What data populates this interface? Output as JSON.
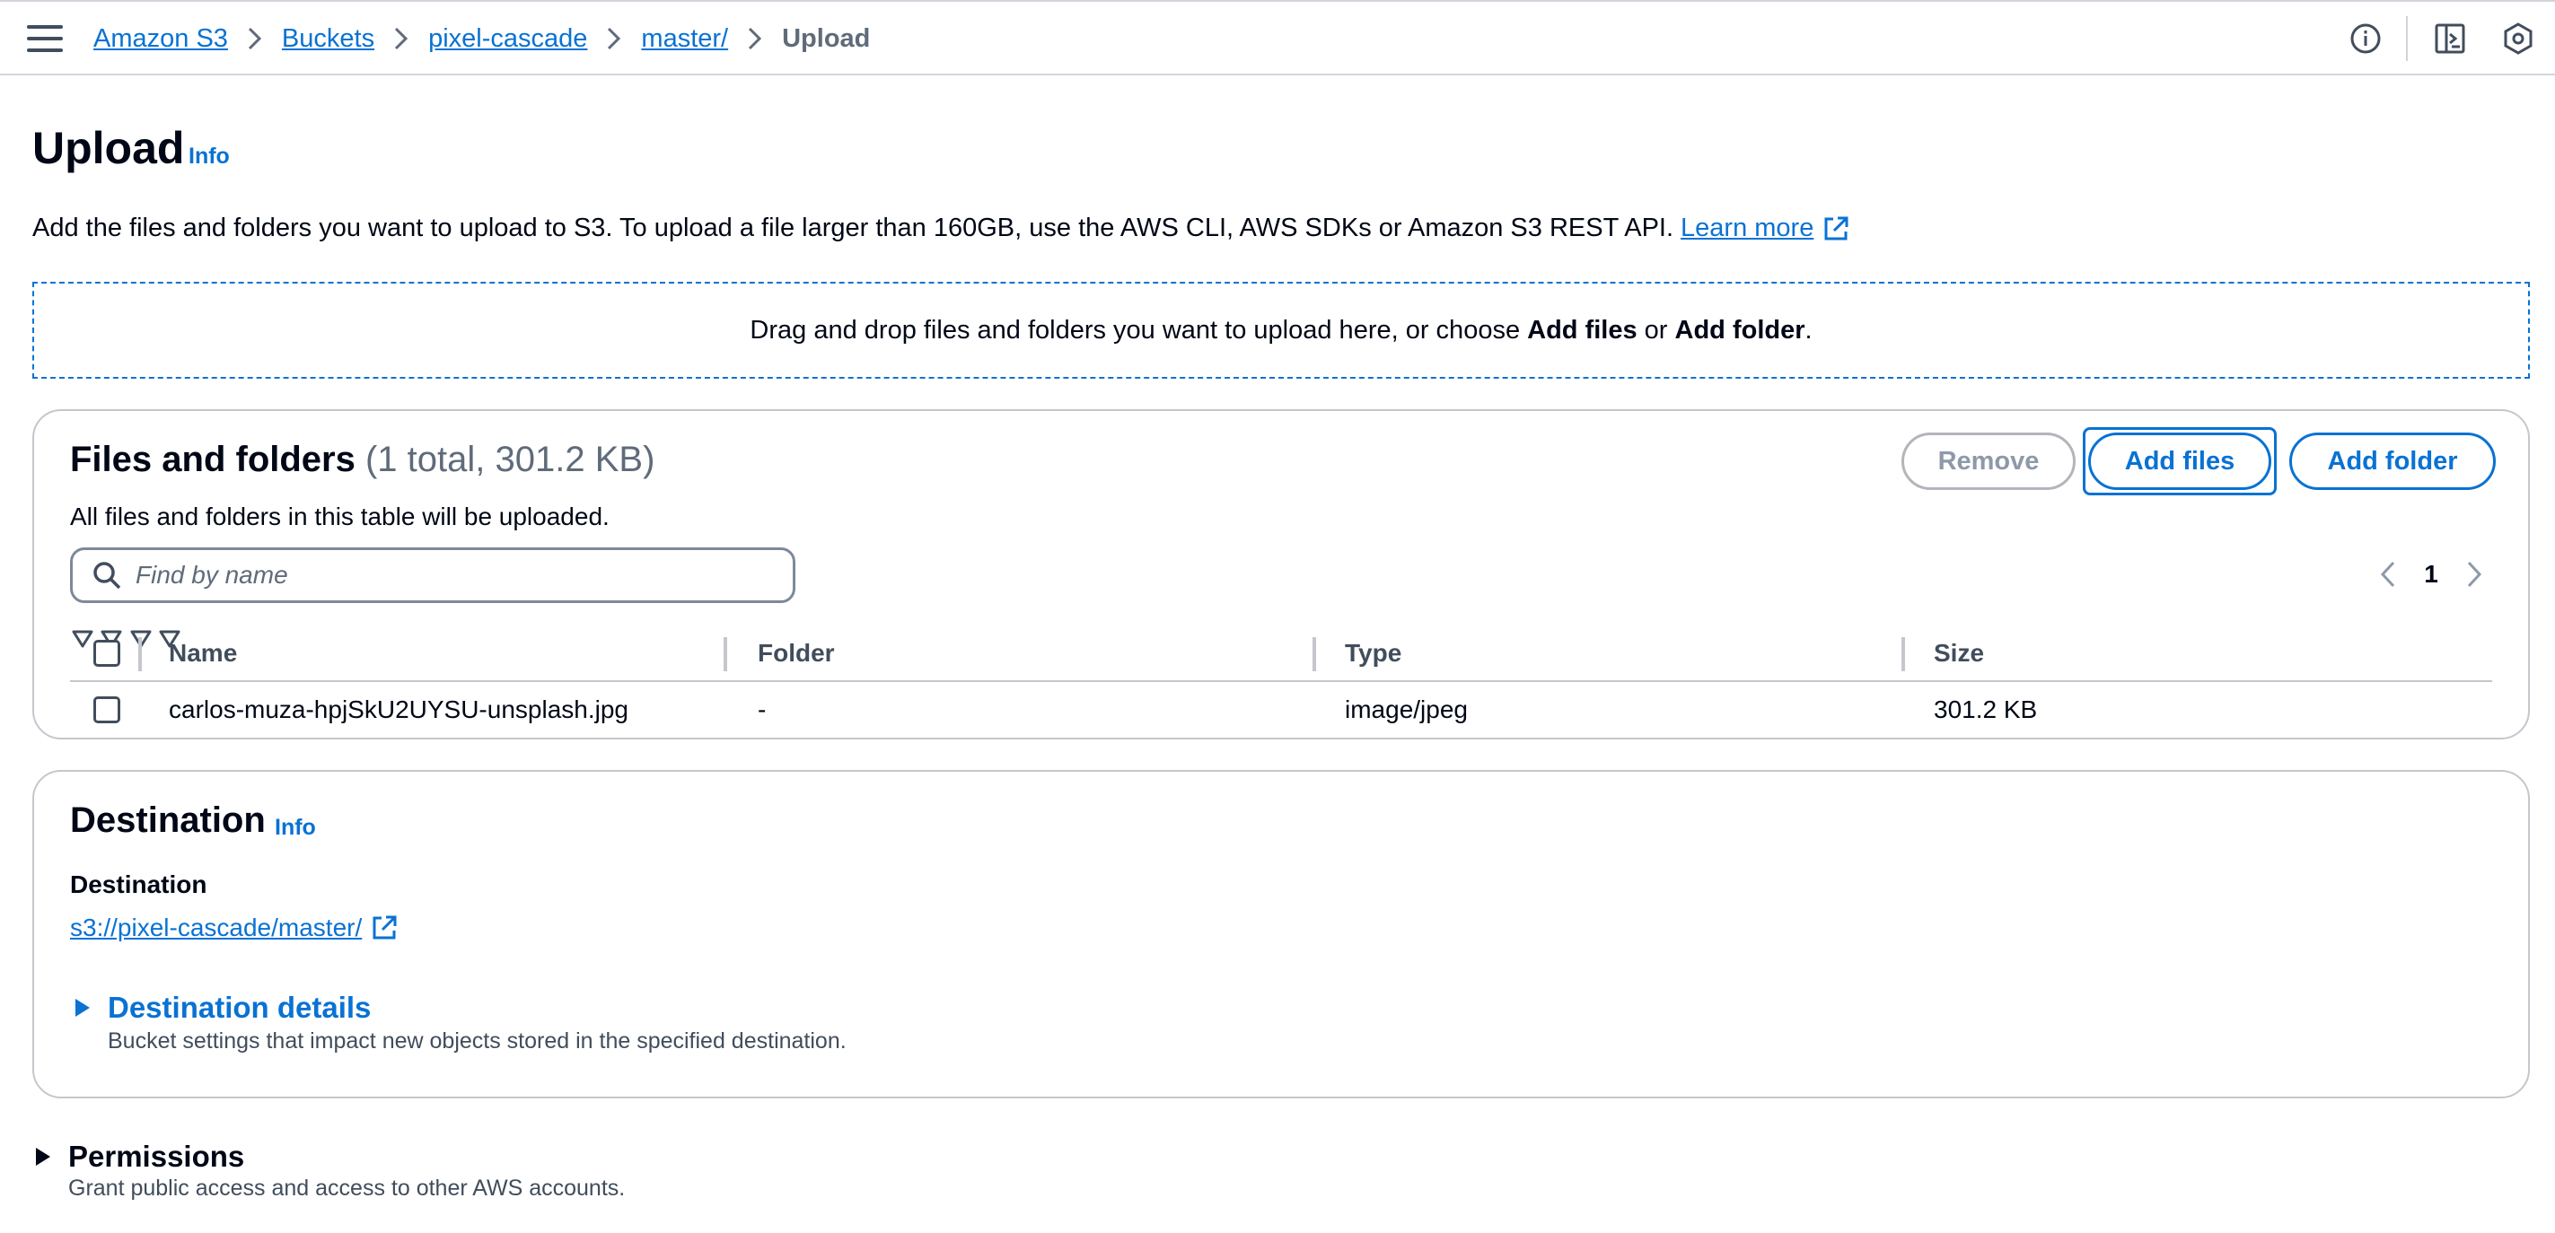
{
  "topbar": {
    "breadcrumbs": [
      {
        "label": "Amazon S3"
      },
      {
        "label": "Buckets"
      },
      {
        "label": "pixel-cascade"
      },
      {
        "label": "master/"
      }
    ],
    "current": "Upload",
    "icons": [
      "info-circle-icon",
      "side-panel-icon",
      "settings-hex-icon"
    ]
  },
  "header": {
    "title": "Upload",
    "info": "Info",
    "description": "Add the files and folders you want to upload to S3. To upload a file larger than 160GB, use the AWS CLI, AWS SDKs or Amazon S3 REST API.",
    "learn_more": "Learn more"
  },
  "dropzone": {
    "text_before": "Drag and drop files and folders you want to upload here, or choose ",
    "add_files": "Add files",
    "or": " or ",
    "add_folder": "Add folder",
    "period": "."
  },
  "files": {
    "title": "Files and folders",
    "count": "(1 total, 301.2 KB)",
    "subtitle": "All files and folders in this table will be uploaded.",
    "buttons": {
      "remove": "Remove",
      "add_files": "Add files",
      "add_folder": "Add folder"
    },
    "search_placeholder": "Find by name",
    "page": "1",
    "columns": [
      "Name",
      "Folder",
      "Type",
      "Size"
    ],
    "rows": [
      {
        "name": "carlos-muza-hpjSkU2UYSU-unsplash.jpg",
        "folder": "-",
        "type": "image/jpeg",
        "size": "301.2 KB"
      }
    ]
  },
  "destination": {
    "title": "Destination",
    "info": "Info",
    "label": "Destination",
    "url": "s3://pixel-cascade/master/",
    "details_title": "Destination details",
    "details_desc": "Bucket settings that impact new objects stored in the specified destination."
  },
  "permissions": {
    "title": "Permissions",
    "desc": "Grant public access and access to other AWS accounts."
  },
  "colors": {
    "link": "#0972d3",
    "text": "#000716",
    "muted": "#5f6b7a",
    "border": "#c6c6cd"
  }
}
